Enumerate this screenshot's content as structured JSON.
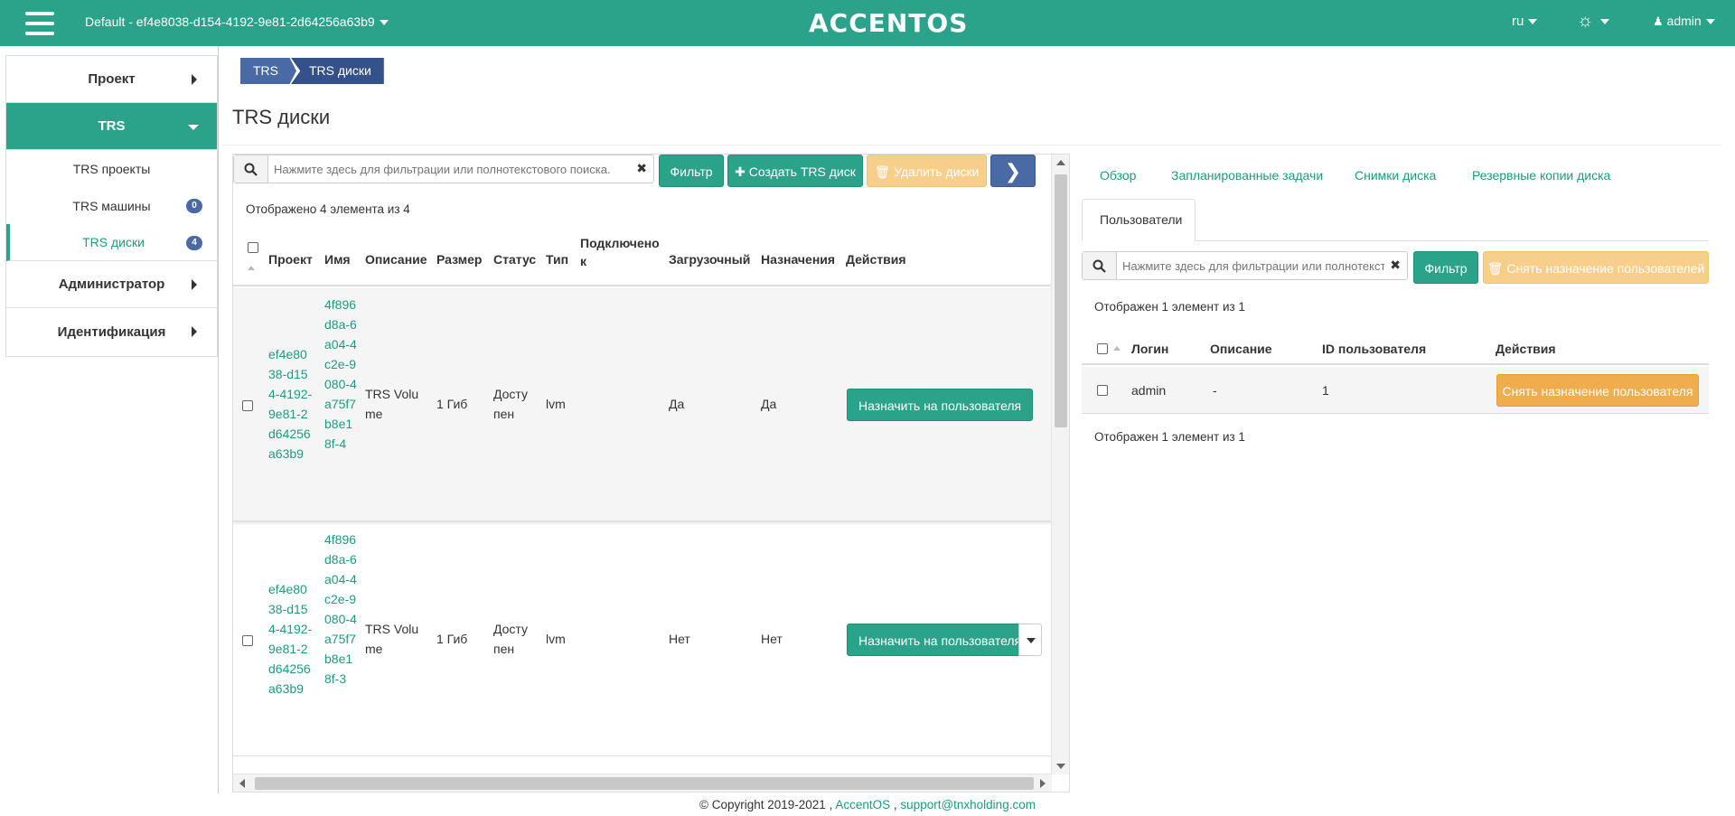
{
  "topbar": {
    "project": "Default - ef4e8038-d154-4192-9e81-2d64256a63b9",
    "logo": "ACCENTOS",
    "lang": "ru",
    "user": "admin"
  },
  "sidebar": {
    "items": [
      {
        "label": "Проект"
      },
      {
        "label": "TRS"
      },
      {
        "label": "Администратор"
      },
      {
        "label": "Идентификация"
      }
    ],
    "sub": [
      {
        "label": "TRS проекты",
        "badge": ""
      },
      {
        "label": "TRS машины",
        "badge": "0"
      },
      {
        "label": "TRS диски",
        "badge": "4"
      }
    ]
  },
  "breadcrumb": [
    "TRS",
    "TRS диски"
  ],
  "page_title": "TRS диски",
  "left": {
    "search_placeholder": "Нажмите здесь для фильтрации или полнотекстового поиска.",
    "filter_label": "Фильтр",
    "create_label": "Создать TRS диск",
    "delete_label": "Удалить диски",
    "count_text": "Отображено 4 элемента из 4",
    "columns": [
      "Проект",
      "Имя",
      "Описание",
      "Размер",
      "Статус",
      "Тип",
      "Подключено к",
      "Загрузочный",
      "Назначения",
      "Действия"
    ],
    "rows": [
      {
        "project": "ef4e8038-d154-4192-9e81-2d64256a63b9",
        "name": "4f896d8a-6a04-4c2e-9080-4a75f7b8e18f-4",
        "description": "TRS Volume",
        "size": "1 Гиб",
        "status": "Доступен",
        "type": "lvm",
        "attached": "",
        "bootable": "Да",
        "assigned": "Да",
        "action": "Назначить на пользователя"
      },
      {
        "project": "ef4e8038-d154-4192-9e81-2d64256a63b9",
        "name": "4f896d8a-6a04-4c2e-9080-4a75f7b8e18f-3",
        "description": "TRS Volume",
        "size": "1 Гиб",
        "status": "Доступен",
        "type": "lvm",
        "attached": "",
        "bootable": "Нет",
        "assigned": "Нет",
        "action": "Назначить на пользователя"
      }
    ]
  },
  "right": {
    "tabs": [
      "Обзор",
      "Запланированные задачи",
      "Снимки диска",
      "Резервные копии диска"
    ],
    "active_tab": "Пользователи",
    "search_placeholder": "Нажмите здесь для фильтрации или полнотекстового поиска.",
    "filter_label": "Фильтр",
    "unassign_label": "Снять назначение пользователей",
    "count_text": "Отображен 1 элемент из 1",
    "columns": [
      "Логин",
      "Описание",
      "ID пользователя",
      "Действия"
    ],
    "rows": [
      {
        "login": "admin",
        "description": "-",
        "id": "1",
        "action": "Снять назначение пользователя"
      }
    ]
  },
  "footer": {
    "copyright": "© Copyright 2019-2021 ,",
    "brand": "AccentOS",
    "sep": ",",
    "email": "support@tnxholding.com"
  }
}
